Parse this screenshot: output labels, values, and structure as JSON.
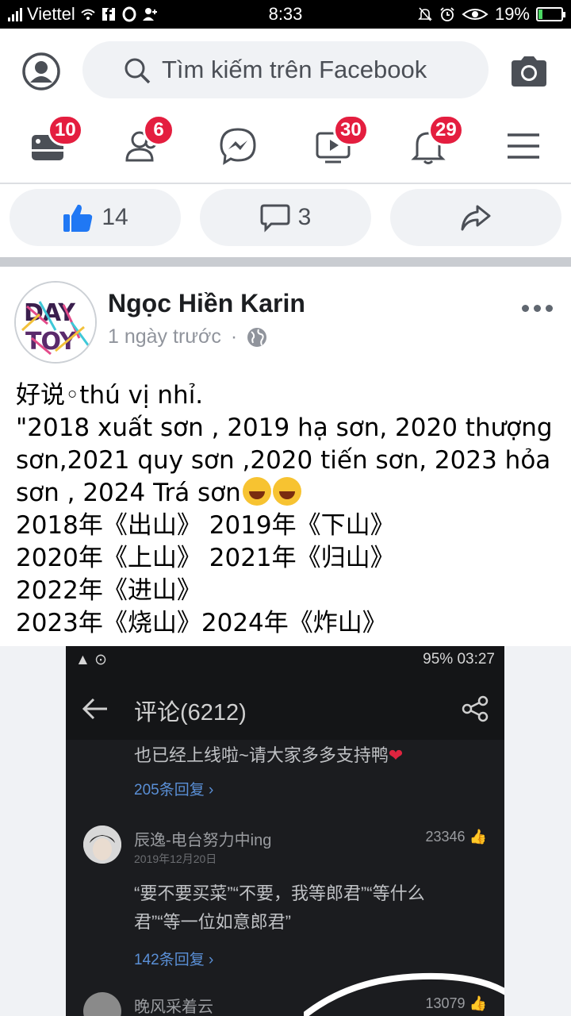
{
  "status_bar": {
    "carrier": "Viettel",
    "time": "8:33",
    "battery_percent": "19%",
    "battery_level": 0.19
  },
  "top_bar": {
    "search_placeholder": "Tìm kiếm trên Facebook"
  },
  "nav": {
    "items": [
      {
        "icon": "news-feed-icon",
        "badge": "10"
      },
      {
        "icon": "friends-icon",
        "badge": "6"
      },
      {
        "icon": "messenger-icon",
        "badge": ""
      },
      {
        "icon": "watch-icon",
        "badge": "30"
      },
      {
        "icon": "notifications-icon",
        "badge": "29"
      },
      {
        "icon": "menu-icon",
        "badge": ""
      }
    ]
  },
  "reactions": {
    "like_count": "14",
    "comment_count": "3"
  },
  "post": {
    "author": "Ngọc Hiền Karin",
    "time": "1 ngày trước",
    "separator": "·",
    "avatar_logo": "DAY TOY",
    "text_lines": [
      "好说◦thú vị nhỉ.",
      "\"2018 xuất sơn , 2019 hạ sơn, 2020 thượng sơn,2021 quy sơn ,2020 tiến sơn, 2023 hỏa sơn , 2024 Trá sơn",
      "2018年《出山》 2019年《下山》",
      "2020年《上山》 2021年《归山》",
      "2022年《进山》",
      "2023年《烧山》2024年《炸山》"
    ]
  },
  "embedded_screenshot": {
    "status_left": "▲ ⊙",
    "status_right": "95% 03:27",
    "title": "评论(6212)",
    "comments": [
      {
        "text": "也已经上线啦~请大家多多支持鸭",
        "replies": "205条回复 ›"
      },
      {
        "name": "辰逸-电台努力中ing",
        "date": "2019年12月20日",
        "likes": "23346",
        "text_line1": "“要不要买菜”“不要，我等郎君”“等什么",
        "text_line2": "君”“等一位如意郎君”",
        "replies": "142条回复 ›"
      },
      {
        "name": "晚风采着云",
        "likes": "13079"
      }
    ]
  }
}
